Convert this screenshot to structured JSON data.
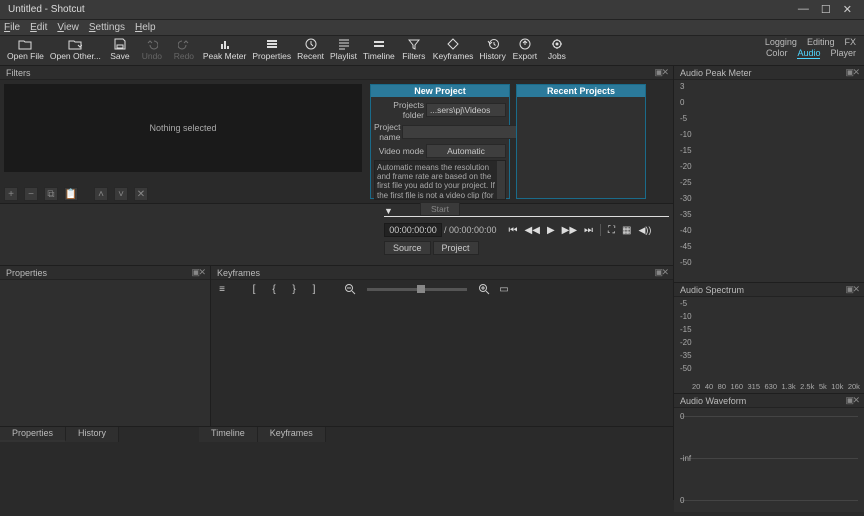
{
  "window": {
    "title": "Untitled - Shotcut"
  },
  "menu": [
    "File",
    "Edit",
    "View",
    "Settings",
    "Help"
  ],
  "toolbar": [
    {
      "label": "Open File"
    },
    {
      "label": "Open Other..."
    },
    {
      "label": "Save"
    },
    {
      "label": "Undo",
      "disabled": true
    },
    {
      "label": "Redo",
      "disabled": true
    },
    {
      "label": "Peak Meter"
    },
    {
      "label": "Properties"
    },
    {
      "label": "Recent"
    },
    {
      "label": "Playlist"
    },
    {
      "label": "Timeline"
    },
    {
      "label": "Filters"
    },
    {
      "label": "Keyframes"
    },
    {
      "label": "History"
    },
    {
      "label": "Export"
    },
    {
      "label": "Jobs"
    }
  ],
  "modes": {
    "row1": [
      "Logging",
      "Editing",
      "FX"
    ],
    "row2": [
      "Color",
      "Audio",
      "Player"
    ],
    "active": "Audio"
  },
  "filters": {
    "title": "Filters",
    "empty_message": "Nothing selected"
  },
  "new_project": {
    "title": "New Project",
    "recent_title": "Recent Projects",
    "folder_label": "Projects folder",
    "folder_value": "...sers\\pj\\Videos",
    "name_label": "Project name",
    "name_value": "",
    "mode_label": "Video mode",
    "mode_value": "Automatic",
    "description": "Automatic means the resolution and frame rate are based on the first file you add to your project. If the first file is not a video clip (for example,",
    "start": "Start"
  },
  "playback": {
    "timecode": "00:00:00:00",
    "duration": "/ 00:00:00:00",
    "tabs": [
      "Source",
      "Project"
    ]
  },
  "properties": {
    "title": "Properties"
  },
  "keyframes": {
    "title": "Keyframes"
  },
  "bottom_tabs_left": [
    "Properties",
    "History"
  ],
  "bottom_tabs_right": [
    "Timeline",
    "Keyframes"
  ],
  "audio": {
    "peak_title": "Audio Peak Meter",
    "peak_scale": [
      "3",
      "0",
      "-5",
      "-10",
      "-15",
      "-20",
      "-25",
      "-30",
      "-35",
      "-40",
      "-45",
      "-50"
    ],
    "spectrum_title": "Audio Spectrum",
    "spectrum_y": [
      "-5",
      "-10",
      "-15",
      "-20",
      "-35",
      "-50"
    ],
    "spectrum_x": [
      "20",
      "40",
      "80",
      "160",
      "315",
      "630",
      "1.3k",
      "2.5k",
      "5k",
      "10k",
      "20k"
    ],
    "waveform_title": "Audio Waveform",
    "wave_labels": [
      "0",
      "-inf",
      "0"
    ]
  }
}
